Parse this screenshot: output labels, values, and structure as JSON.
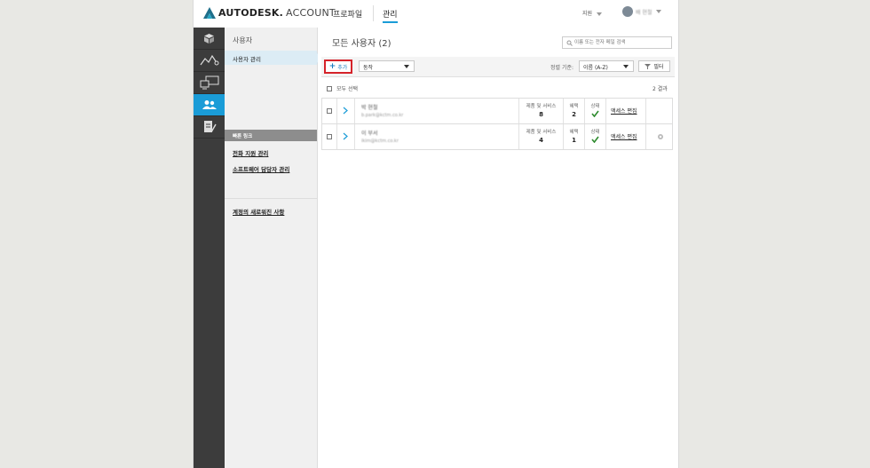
{
  "brand": {
    "name": "AUTODESK.",
    "product": "ACCOUNT"
  },
  "header": {
    "tabs": [
      {
        "label": "프로파일"
      },
      {
        "label": "관리"
      }
    ],
    "help_label": "지원",
    "user_name": "배 현철"
  },
  "rail": {
    "items": [
      {
        "icon": "box-icon"
      },
      {
        "icon": "usage-chart-icon"
      },
      {
        "icon": "devices-icon"
      },
      {
        "icon": "users-icon",
        "active": true
      },
      {
        "icon": "report-icon"
      }
    ]
  },
  "subnav": {
    "title": "사용자",
    "active_item": "사용자 관리",
    "quick_links_title": "빠른 링크",
    "links": [
      "전화 지원 관리",
      "소프트웨어 담당자 관리"
    ],
    "whats_new": "계정의 새로워진 사항"
  },
  "main": {
    "title": "모든 사용자 (2)",
    "search_placeholder": "이름 또는 전자 메일 검색",
    "add_label": "추가",
    "action_select": "동작",
    "sort_label": "정렬 기준:",
    "sort_value": "이름 (A-Z)",
    "filter_label": "필터",
    "select_all": "모두 선택",
    "result_count": "2 결과",
    "columns": {
      "products": "제품 및 서비스",
      "benefits": "혜택",
      "status": "상태"
    },
    "access_edit": "액세스 편집",
    "users": [
      {
        "name": "박 현철",
        "email": "b.park@kctm.co.kr",
        "products": "8",
        "benefits": "2"
      },
      {
        "name": "이 부서",
        "email": "ikim@kctm.co.kr",
        "products": "4",
        "benefits": "1"
      }
    ]
  },
  "colors": {
    "accent": "#1a9cd7",
    "rail": "#3c3c3c",
    "highlight_border": "#d5232a",
    "check": "#2e8b2e"
  }
}
